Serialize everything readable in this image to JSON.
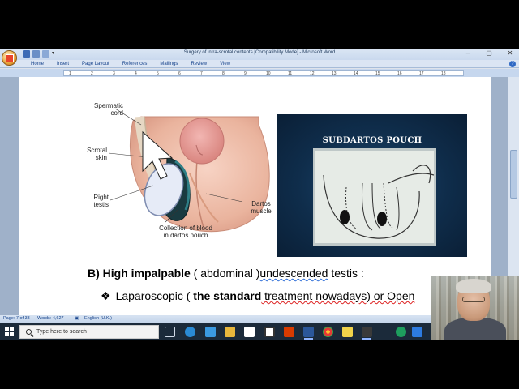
{
  "window": {
    "title": "Surgery of intra-scrotal contents [Compatibility Mode] - Microsoft Word",
    "controls": [
      "–",
      "▢",
      "✕"
    ]
  },
  "ribbon": {
    "tabs": [
      "Home",
      "Insert",
      "Page Layout",
      "References",
      "Mailings",
      "Review",
      "View"
    ]
  },
  "ruler": {
    "ticks": [
      "1",
      "2",
      "3",
      "4",
      "5",
      "6",
      "7",
      "8",
      "9",
      "10",
      "11",
      "12",
      "13",
      "14",
      "15",
      "16",
      "17",
      "18"
    ]
  },
  "figure_left": {
    "labels": {
      "spermatic_cord": "Spermatic\ncord",
      "scrotal_skin": "Scrotal\nskin",
      "right_testis": "Right\ntestis",
      "collection": "Collection of blood\nin dartos pouch",
      "dartos": "Dartos\nmuscle"
    }
  },
  "figure_right": {
    "title": "SUBDARTOS POUCH"
  },
  "document": {
    "heading_prefix": "B) ",
    "heading_bold": "High impalpable",
    "heading_rest_1": " ( abdominal )",
    "heading_squiggle": "undescended",
    "heading_rest_2": " testis :",
    "bullet_symbol": "❖",
    "bullet_text_1": "Laparoscopic ( ",
    "bullet_bold": "the standard",
    "bullet_text_2": " treatment nowadays) or Open"
  },
  "statusbar": {
    "page": "Page: 7 of 33",
    "words": "Words: 4,627",
    "language": "English (U.K.)"
  },
  "taskbar": {
    "search_placeholder": "Type here to search"
  },
  "colors": {
    "ribbon_blue": "#dbe5f3",
    "taskbar": "#1b2a3a",
    "slide_bg": "#0f2d4b"
  }
}
